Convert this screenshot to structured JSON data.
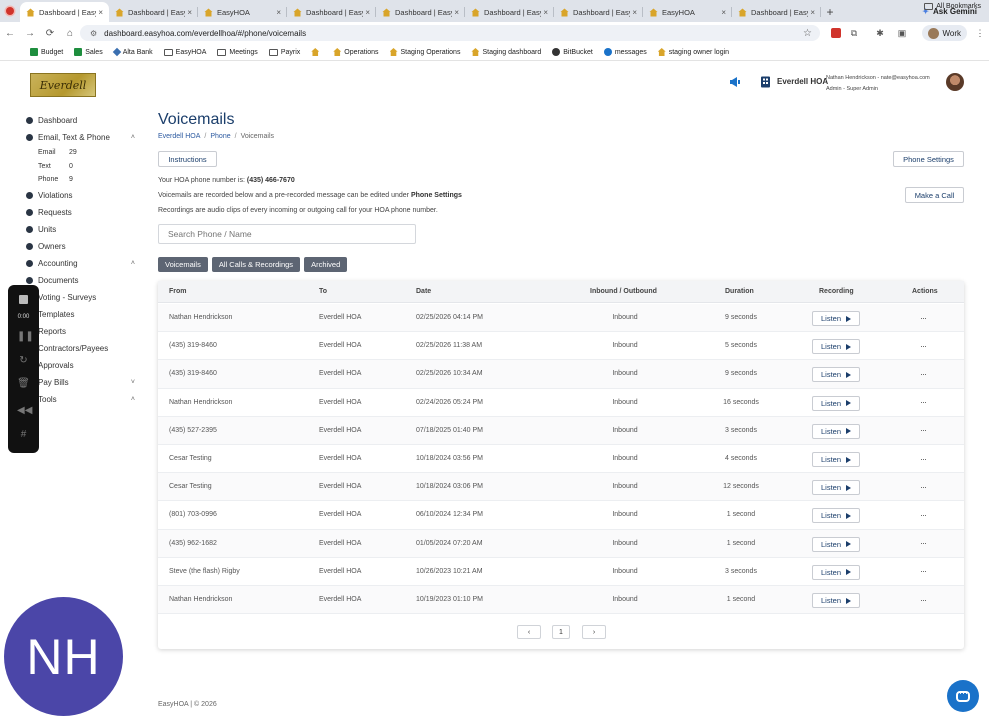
{
  "browser": {
    "tabs": [
      {
        "label": "Dashboard | Easy",
        "active": true
      },
      {
        "label": "Dashboard | Easy"
      },
      {
        "label": "EasyHOA"
      },
      {
        "label": "Dashboard | Easy"
      },
      {
        "label": "Dashboard | Easy"
      },
      {
        "label": "Dashboard | Easy"
      },
      {
        "label": "Dashboard | Easy"
      },
      {
        "label": "EasyHOA"
      },
      {
        "label": "Dashboard | Easy"
      }
    ],
    "gemini_label": "Ask Gemini",
    "url": "dashboard.easyhoa.com/everdellhoa/#/phone/voicemails",
    "profile_label": "Work",
    "bookmarks": [
      "Budget",
      "Sales",
      "Alta Bank",
      "EasyHOA",
      "Meetings",
      "Payrix",
      "",
      "Operations",
      "Staging Operations",
      "Staging dashboard",
      "BitBucket",
      "messages",
      "staging owner login"
    ],
    "all_bookmarks": "All Bookmarks"
  },
  "header": {
    "logo_text": "Everdell",
    "org_name": "Everdell HOA",
    "user_line": "Nathan Hendrickson - nate@easyhoa.com",
    "role_line": "Admin - Super Admin"
  },
  "sidebar": {
    "items": [
      {
        "label": "Dashboard"
      },
      {
        "label": "Email, Text & Phone"
      },
      {
        "label": "Violations"
      },
      {
        "label": "Requests"
      },
      {
        "label": "Units"
      },
      {
        "label": "Owners"
      },
      {
        "label": "Accounting"
      },
      {
        "label": "Documents"
      },
      {
        "label": "Voting - Surveys"
      },
      {
        "label": "Templates"
      },
      {
        "label": "Reports"
      },
      {
        "label": "Contractors/Payees"
      },
      {
        "label": "Approvals"
      },
      {
        "label": "Pay Bills"
      },
      {
        "label": "Tools"
      }
    ],
    "sub": [
      {
        "label": "Email",
        "count": "29"
      },
      {
        "label": "Text",
        "count": "0"
      },
      {
        "label": "Phone",
        "count": "9"
      }
    ]
  },
  "recorder": {
    "time": "0:00"
  },
  "page": {
    "title": "Voicemails",
    "breadcrumb": [
      "Everdell HOA",
      "Phone",
      "Voicemails"
    ],
    "instructions_button": "Instructions",
    "phone_settings_button": "Phone Settings",
    "make_call_button": "Make a Call",
    "phone_number_prefix": "Your HOA phone number is:",
    "phone_number": "(435) 466-7670",
    "info_line_1": "Voicemails are recorded below and a pre-recorded message can be edited under",
    "info_line_1_bold": "Phone Settings",
    "info_line_2": "Recordings are audio clips of every incoming or outgoing call for your HOA phone number.",
    "search_placeholder": "Search Phone / Name",
    "filter_tabs": [
      "Voicemails",
      "All Calls & Recordings",
      "Archived"
    ]
  },
  "table": {
    "headers": [
      "From",
      "To",
      "Date",
      "Inbound / Outbound",
      "Duration",
      "Recording",
      "Actions"
    ],
    "listen_label": "Listen",
    "actions_label": "···",
    "rows": [
      {
        "from": "Nathan Hendrickson",
        "to": "Everdell HOA",
        "date": "02/25/2026 04:14 PM",
        "direction": "Inbound",
        "duration": "9 seconds"
      },
      {
        "from": "(435) 319-8460",
        "to": "Everdell HOA",
        "date": "02/25/2026 11:38 AM",
        "direction": "Inbound",
        "duration": "5 seconds"
      },
      {
        "from": "(435) 319-8460",
        "to": "Everdell HOA",
        "date": "02/25/2026 10:34 AM",
        "direction": "Inbound",
        "duration": "9 seconds"
      },
      {
        "from": "Nathan Hendrickson",
        "to": "Everdell HOA",
        "date": "02/24/2026 05:24 PM",
        "direction": "Inbound",
        "duration": "16 seconds"
      },
      {
        "from": "(435) 527-2395",
        "to": "Everdell HOA",
        "date": "07/18/2025 01:40 PM",
        "direction": "Inbound",
        "duration": "3 seconds"
      },
      {
        "from": "Cesar Testing",
        "to": "Everdell HOA",
        "date": "10/18/2024 03:56 PM",
        "direction": "Inbound",
        "duration": "4 seconds"
      },
      {
        "from": "Cesar Testing",
        "to": "Everdell HOA",
        "date": "10/18/2024 03:06 PM",
        "direction": "Inbound",
        "duration": "12 seconds"
      },
      {
        "from": "(801) 703-0996",
        "to": "Everdell HOA",
        "date": "06/10/2024 12:34 PM",
        "direction": "Inbound",
        "duration": "1 second"
      },
      {
        "from": "(435) 962-1682",
        "to": "Everdell HOA",
        "date": "01/05/2024 07:20 AM",
        "direction": "Inbound",
        "duration": "1 second"
      },
      {
        "from": "Steve (the flash) Rigby",
        "to": "Everdell HOA",
        "date": "10/26/2023 10:21 AM",
        "direction": "Inbound",
        "duration": "3 seconds"
      },
      {
        "from": "Nathan Hendrickson",
        "to": "Everdell HOA",
        "date": "10/19/2023 01:10 PM",
        "direction": "Inbound",
        "duration": "1 second"
      }
    ]
  },
  "pagination": {
    "prev": "‹",
    "current": "1",
    "next": "›"
  },
  "footer": {
    "text": "EasyHOA | © 2026"
  },
  "overlay": {
    "initials": "NH"
  },
  "colors": {
    "primary": "#1b3e6b",
    "tab_active": "#5d6573",
    "chat": "#1a72c9",
    "avatar_bg": "#4b46a8"
  }
}
